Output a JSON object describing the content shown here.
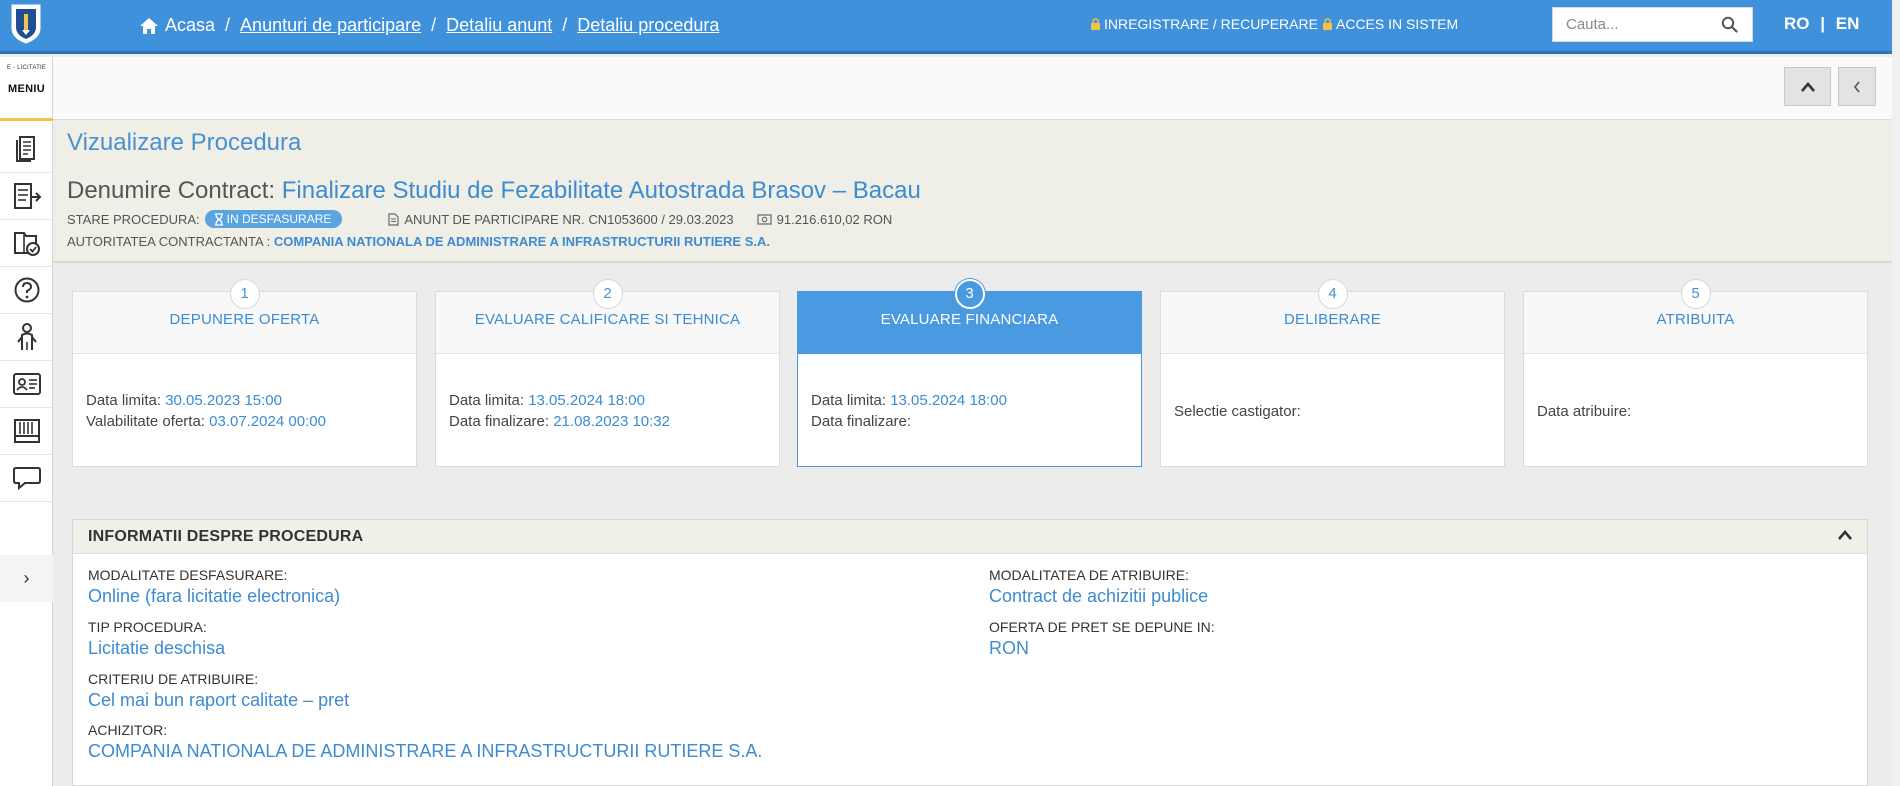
{
  "nav": {
    "home": "Acasa",
    "crumb1": "Anunturi de participare",
    "crumb2": "Detaliu anunt",
    "crumb3": "Detaliu procedura",
    "register": "INREGISTRARE / RECUPERARE",
    "login": "ACCES IN SISTEM",
    "search_placeholder": "Cauta...",
    "lang_ro": "RO",
    "lang_sep": "|",
    "lang_en": "EN"
  },
  "sidebar": {
    "brand": "E - LICITATIE",
    "menu": "MENIU",
    "icons": [
      "document-icon",
      "list-export-icon",
      "folder-check-icon",
      "help-icon",
      "person-icon",
      "id-card-icon",
      "catalog-icon",
      "chat-icon"
    ],
    "toggle": "›"
  },
  "header": {
    "title": "Vizualizare Procedura",
    "contract_label": "Denumire Contract: ",
    "contract_value": "Finalizare Studiu de Fezabilitate Autostrada Brasov – Bacau",
    "status_label": "STARE PROCEDURA:",
    "status_badge": "IN DESFASURARE",
    "notice": "ANUNT DE PARTICIPARE NR. CN1053600 / 29.03.2023",
    "amount": "91.216.610,02  RON",
    "authority_label": "AUTORITATEA CONTRACTANTA : ",
    "authority_value": "COMPANIA NATIONALA DE ADMINISTRARE A INFRASTRUCTURII RUTIERE S.A."
  },
  "steps": [
    {
      "num": "1",
      "title": "DEPUNERE OFERTA",
      "l1": "Data limita: ",
      "v1": "30.05.2023 15:00",
      "l2": "Valabilitate oferta: ",
      "v2": "03.07.2024 00:00"
    },
    {
      "num": "2",
      "title": "EVALUARE CALIFICARE SI TEHNICA",
      "l1": "Data limita: ",
      "v1": "13.05.2024 18:00",
      "l2": "Data finalizare: ",
      "v2": "21.08.2023 10:32"
    },
    {
      "num": "3",
      "title": "EVALUARE FINANCIARA",
      "l1": "Data limita: ",
      "v1": "13.05.2024 18:00",
      "l2": "Data finalizare:",
      "v2": ""
    },
    {
      "num": "4",
      "title": "DELIBERARE",
      "l1": "Selectie castigator:"
    },
    {
      "num": "5",
      "title": "ATRIBUITA",
      "l1": "Data atribuire:"
    }
  ],
  "info": {
    "title": "INFORMATII DESPRE PROCEDURA",
    "modalitate_label": "MODALITATE DESFASURARE:",
    "modalitate_value": "Online (fara licitatie electronica)",
    "tip_label": "TIP PROCEDURA:",
    "tip_value": "Licitatie deschisa",
    "criteriu_label": "CRITERIU DE ATRIBUIRE:",
    "criteriu_value": "Cel mai bun raport calitate – pret",
    "achizitor_label": "ACHIZITOR:",
    "achizitor_value": "COMPANIA NATIONALA DE ADMINISTRARE A INFRASTRUCTURII RUTIERE S.A.",
    "atribuire_label": "MODALITATEA DE ATRIBUIRE:",
    "atribuire_value": "Contract de achizitii publice",
    "moneda_label": "OFERTA DE PRET SE DEPUNE IN:",
    "moneda_value": "RON"
  },
  "colors": {
    "primary": "#4091dc",
    "accent": "#f4c14a",
    "link": "#3d8bd0",
    "active_step": "#4a9ae2"
  }
}
